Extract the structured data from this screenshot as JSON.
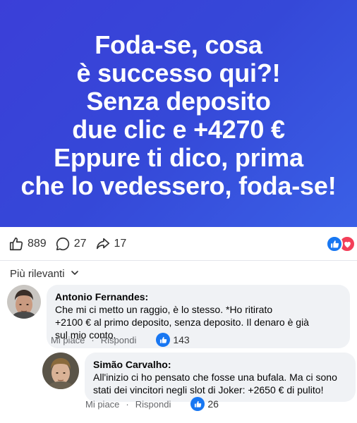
{
  "banner": {
    "lines": [
      "Foda-se, cosa",
      "è successo qui?!",
      "Senza deposito",
      "due clic e +4270 €",
      "Eppure ti dico, prima",
      "che lo vedessero, foda-se!"
    ]
  },
  "stats": {
    "likes": "889",
    "comments": "27",
    "shares": "17"
  },
  "sort": {
    "label": "Più rilevanti"
  },
  "comments": [
    {
      "author": "Antonio Fernandes:",
      "lines": [
        "Che mi ci metto un raggio, è lo stesso.  *Ho ritirato",
        "+2100 € al primo deposito, senza deposito. Il denaro è già",
        "sul mio conto."
      ],
      "like_label": "Mi piace",
      "reply_label": "Rispondi",
      "like_count": "143"
    },
    {
      "author": "Simão Carvalho:",
      "lines": [
        "All'inizio ci ho pensato che fosse una bufala. Ma ci sono",
        "stati dei vincitori negli slot di Joker: +2650 € di pulito!"
      ],
      "like_label": "Mi piace",
      "reply_label": "Rispondi",
      "like_count": "26"
    }
  ],
  "colors": {
    "banner_start": "#3b3fd8",
    "banner_end": "#3a60e6",
    "like_blue": "#1877f2",
    "love_red": "#f33e58",
    "bubble_bg": "#f0f2f5"
  }
}
